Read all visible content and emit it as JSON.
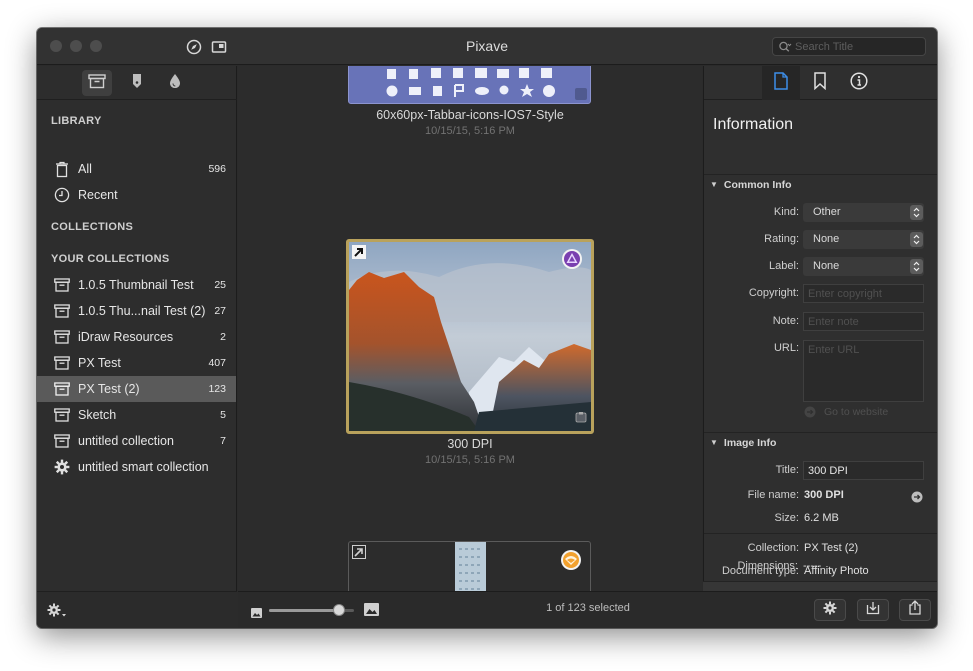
{
  "window": {
    "title": "Pixave"
  },
  "search": {
    "placeholder": "Search Title"
  },
  "sidebar": {
    "library_header": "LIBRARY",
    "library_items": [
      {
        "label": "All",
        "count": "596",
        "icon": "trash-can-icon"
      },
      {
        "label": "Recent",
        "count": "",
        "icon": "clock-icon"
      }
    ],
    "collections_header": "COLLECTIONS",
    "your_collections_header": "YOUR COLLECTIONS",
    "collections": [
      {
        "label": "1.0.5 Thumbnail Test",
        "count": "25"
      },
      {
        "label": "1.0.5 Thu...nail Test (2)",
        "count": "27"
      },
      {
        "label": "iDraw Resources",
        "count": "2"
      },
      {
        "label": "PX Test",
        "count": "407"
      },
      {
        "label": "PX Test (2)",
        "count": "123",
        "selected": true
      },
      {
        "label": "Sketch",
        "count": "5"
      },
      {
        "label": "untitled collection",
        "count": "7"
      },
      {
        "label": "untitled smart collection",
        "count": ""
      }
    ]
  },
  "grid": {
    "items": [
      {
        "caption": "60x60px-Tabbar-icons-IOS7-Style",
        "date": "10/15/15, 5:16 PM"
      },
      {
        "caption": "300 DPI",
        "date": "10/15/15, 5:16 PM",
        "selected": true
      },
      {
        "caption": "",
        "date": ""
      }
    ]
  },
  "status": {
    "selection_text": "1 of 123 selected",
    "zoom_level": 0.82
  },
  "inspector": {
    "title": "Information",
    "common_info_header": "Common Info",
    "kind_label": "Kind:",
    "kind_value": "Other",
    "rating_label": "Rating:",
    "rating_value": "None",
    "label_label": "Label:",
    "label_value": "None",
    "copyright_label": "Copyright:",
    "copyright_placeholder": "Enter copyright",
    "note_label": "Note:",
    "note_placeholder": "Enter note",
    "url_label": "URL:",
    "url_placeholder": "Enter URL",
    "go_to_website": "Go to website",
    "image_info_header": "Image Info",
    "title_label": "Title:",
    "title_value": "300 DPI",
    "filename_label": "File name:",
    "filename_value": "300 DPI",
    "size_label": "Size:",
    "size_value": "6.2 MB",
    "collection_label": "Collection:",
    "collection_value": "PX Test (2)",
    "doctype_label": "Document type:",
    "doctype_value": "Affinity Photo",
    "dimensions_label": "Dimensions:",
    "dimensions_value": "-----"
  },
  "colors": {
    "selection_border": "#b9a25c",
    "sidebar_selected": "#5a5a5a",
    "affinity_purple": "#7a3fb0",
    "affinity_orange": "#f2a12e"
  }
}
